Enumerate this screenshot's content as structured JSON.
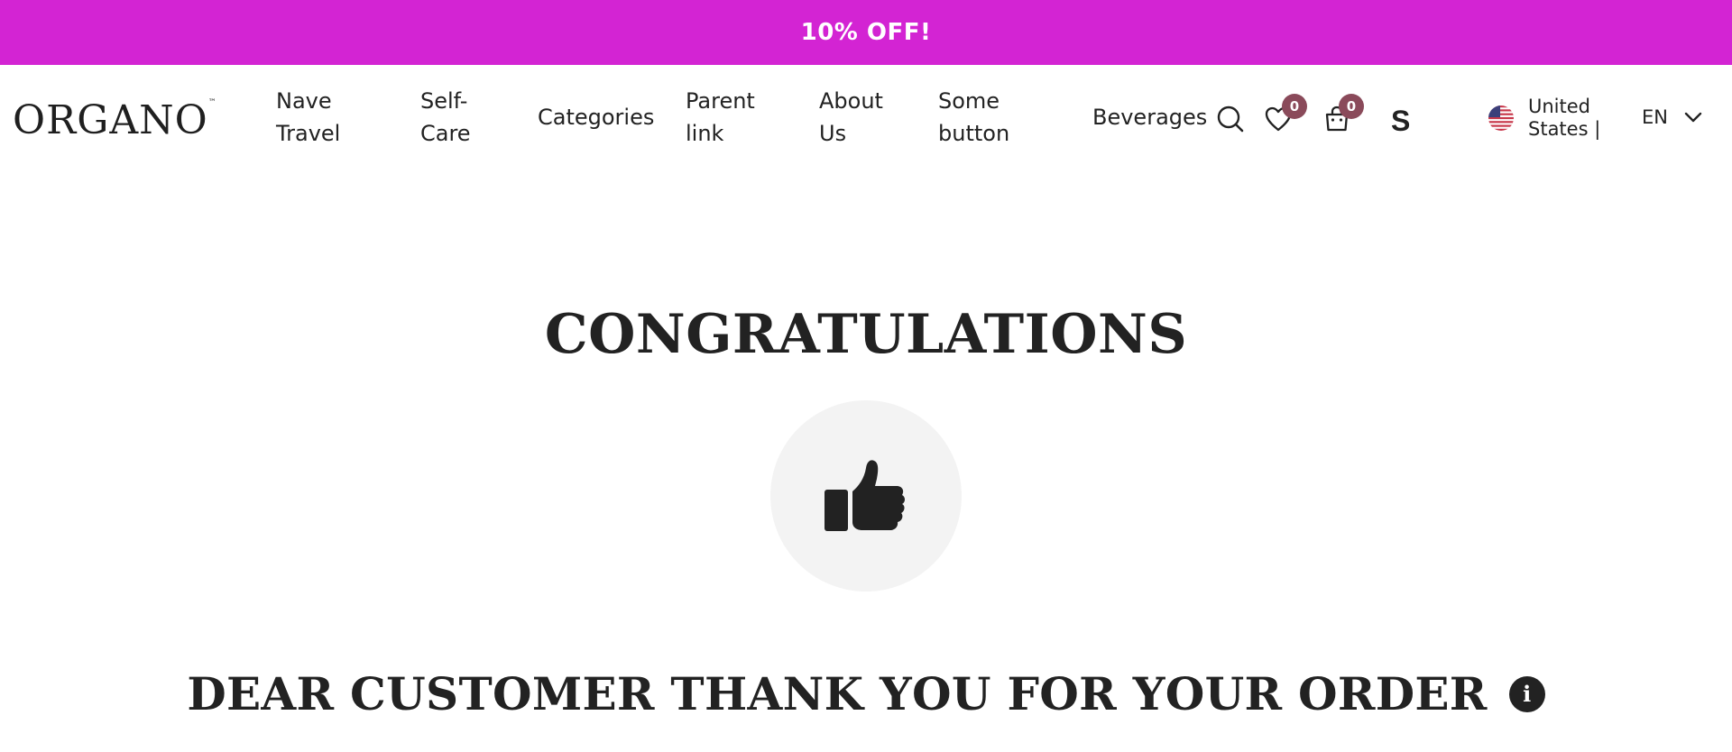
{
  "promo": {
    "text": "10% OFF!"
  },
  "header": {
    "logo": "ORGANO",
    "logo_tm": "™",
    "nav": [
      {
        "label_line1": "Nave",
        "label_line2": "Travel"
      },
      {
        "label_line1": "Self-",
        "label_line2": "Care"
      },
      {
        "label_line1": "Categories"
      },
      {
        "label_line1": "Parent",
        "label_line2": "link"
      },
      {
        "label_line1": "About",
        "label_line2": "Us"
      },
      {
        "label_line1": "Some",
        "label_line2": "button"
      },
      {
        "label_line1": "Beverages"
      }
    ],
    "wishlist_count": "0",
    "cart_count": "0",
    "user_initial": "S",
    "region_line1": "United",
    "region_line2": "States |",
    "language": "EN",
    "icons": [
      "search-icon",
      "heart-icon",
      "shopping-bag-icon",
      "us-flag-icon",
      "chevron-down-icon"
    ]
  },
  "main": {
    "heading": "CONGRATULATIONS",
    "icon": "thumbs-up-icon",
    "message": "DEAR CUSTOMER THANK YOU FOR YOUR ORDER",
    "info_glyph": "i"
  },
  "colors": {
    "promo_bg": "#d324d3",
    "badge_bg": "#8a4a5a",
    "text": "#222222",
    "circle_bg": "#f3f3f3"
  }
}
